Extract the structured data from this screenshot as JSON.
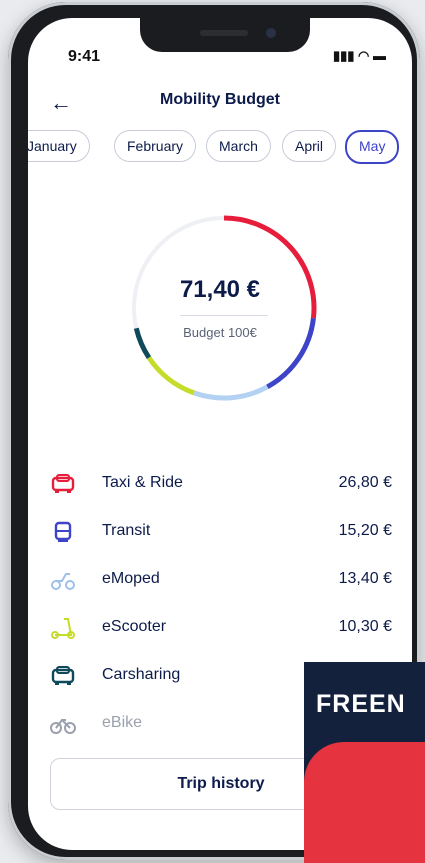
{
  "status": {
    "time": "9:41",
    "icons": "▮▮▮ ◠ ▬"
  },
  "header": {
    "back_icon": "back-arrow-icon",
    "title": "Mobility Budget"
  },
  "months": [
    {
      "label": "January",
      "active": false
    },
    {
      "label": "February",
      "active": false
    },
    {
      "label": "March",
      "active": false
    },
    {
      "label": "April",
      "active": false
    },
    {
      "label": "May",
      "active": true
    }
  ],
  "summary": {
    "amount": "71,40 €",
    "budget": "Budget 100€"
  },
  "chart_data": {
    "type": "pie",
    "categories": [
      "Taxi & Ride",
      "Transit",
      "eMoped",
      "eScooter",
      "Carsharing",
      "Remaining"
    ],
    "values": [
      26.8,
      15.2,
      13.4,
      10.3,
      5.7,
      28.6
    ],
    "colors": [
      "#e61e3c",
      "#3d44c7",
      "#b3d1f2",
      "#c6dc2b",
      "#0f4a5a",
      "#eef0f3"
    ],
    "title": "",
    "style": "ring"
  },
  "expenses": [
    {
      "label": "Taxi & Ride",
      "value": "26,80 €",
      "icon": "car-icon",
      "color": "#e61e3c",
      "muted": false
    },
    {
      "label": "Transit",
      "value": "15,20 €",
      "icon": "tram-icon",
      "color": "#3d44c7",
      "muted": false
    },
    {
      "label": "eMoped",
      "value": "13,40 €",
      "icon": "moped-icon",
      "color": "#9fc0e8",
      "muted": false
    },
    {
      "label": "eScooter",
      "value": "10,30 €",
      "icon": "scooter-icon",
      "color": "#c6dc2b",
      "muted": false
    },
    {
      "label": "Carsharing",
      "value": "",
      "icon": "car-icon",
      "color": "#0f4a5a",
      "muted": false
    },
    {
      "label": "eBike",
      "value": "",
      "icon": "bike-icon",
      "color": "#9aa0ad",
      "muted": true
    }
  ],
  "actions": {
    "trip_history": "Trip history"
  },
  "promo": {
    "text": "FREEN"
  }
}
